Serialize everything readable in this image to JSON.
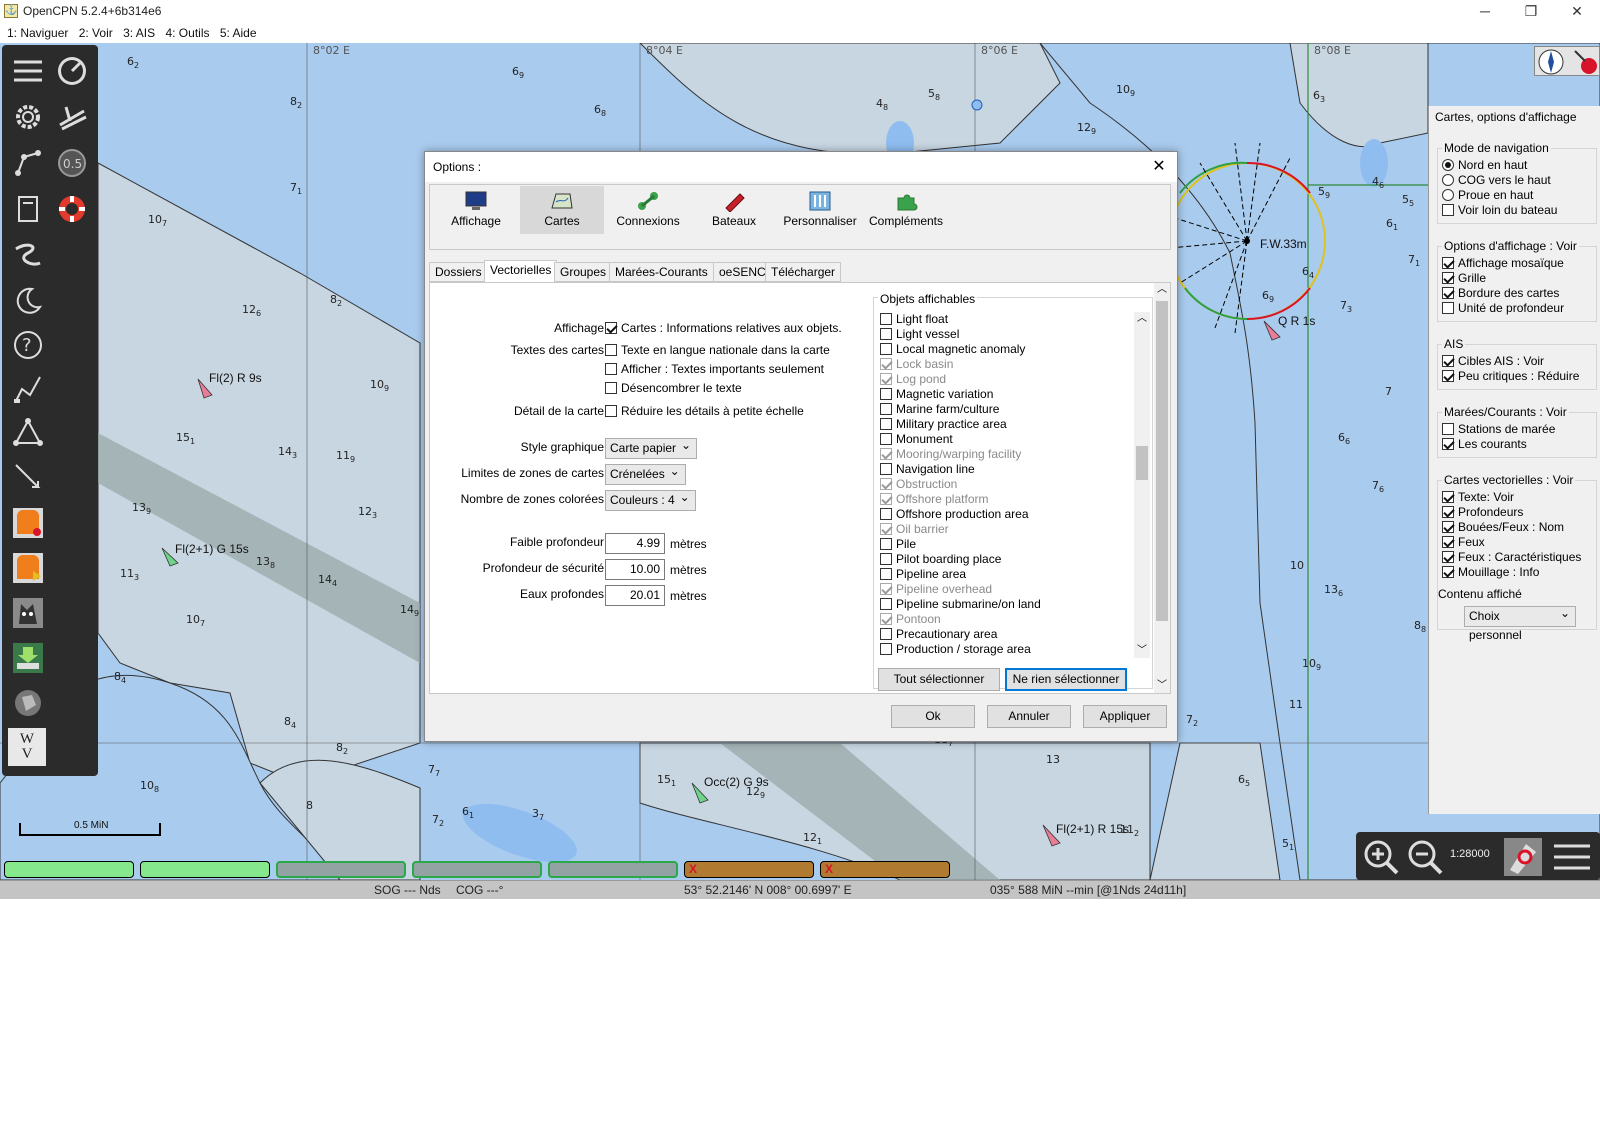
{
  "window": {
    "title": "OpenCPN 5.2.4+6b314e6",
    "app_icon": "chart-icon",
    "controls": [
      "─",
      "❐",
      "✕"
    ]
  },
  "menu": {
    "items": [
      "1: Naviguer",
      "2: Voir",
      "3: AIS",
      "4: Outils",
      "5: Aide"
    ]
  },
  "chart": {
    "grid_labels": [
      "8°02 E",
      "8°04 E",
      "8°06 E",
      "8°08 E"
    ],
    "depths": [
      [
        "6",
        "2"
      ],
      [
        "8",
        "2"
      ],
      [
        "6",
        "9"
      ],
      [
        "6",
        "8"
      ],
      [
        "4",
        "8"
      ],
      [
        "5",
        "8"
      ],
      [
        "10",
        "9"
      ],
      [
        "6",
        "3"
      ],
      [
        "12",
        "9"
      ],
      [
        "7",
        "1"
      ],
      [
        "10",
        "7"
      ],
      [
        "8",
        "2"
      ],
      [
        "12",
        "6"
      ],
      [
        "10",
        "9"
      ],
      [
        "15",
        "1"
      ],
      [
        "14",
        "3"
      ],
      [
        "11",
        "9"
      ],
      [
        "13",
        "9"
      ],
      [
        "12",
        "3"
      ],
      [
        "13",
        "8"
      ],
      [
        "14",
        "4"
      ],
      [
        "11",
        "3"
      ],
      [
        "14",
        "9"
      ],
      [
        "10",
        "7"
      ],
      [
        "8",
        "4"
      ],
      [
        "8",
        "4"
      ],
      [
        "8",
        "2"
      ],
      [
        "7",
        "7"
      ],
      [
        "10",
        "8"
      ],
      [
        "15",
        "1"
      ],
      [
        "12",
        "9"
      ],
      [
        "7",
        "2"
      ],
      [
        "6",
        "1"
      ],
      [
        "3",
        "7"
      ],
      [
        "8",
        ""
      ],
      [
        "11",
        "7"
      ],
      [
        "13",
        ""
      ],
      [
        "6",
        "5"
      ],
      [
        "5",
        "1"
      ],
      [
        "11",
        "2"
      ],
      [
        "12",
        "1"
      ],
      [
        "7",
        "2"
      ],
      [
        "10",
        "9"
      ],
      [
        "13",
        "6"
      ],
      [
        "11",
        "4"
      ],
      [
        "10",
        ""
      ],
      [
        "6",
        "6"
      ],
      [
        "7",
        "6"
      ],
      [
        "7",
        ""
      ],
      [
        "7",
        "3"
      ],
      [
        "6",
        "4"
      ],
      [
        "6",
        "9"
      ],
      [
        "5",
        "9"
      ],
      [
        "4",
        "6"
      ],
      [
        "5",
        "5"
      ],
      [
        "6",
        "1"
      ],
      [
        "7",
        "1"
      ],
      [
        "8",
        "8"
      ],
      [
        "11",
        ""
      ]
    ],
    "buoy_labels": [
      "Fl(2) R 9s",
      "Fl(2+1) G 15s",
      "Occ(2) G 9s",
      "Fl(2+1) R 15s",
      "Q R 1s",
      "F.W.33m"
    ],
    "scale_label": "0.5 MiN",
    "colors": {
      "deep_water": "#a9cbee",
      "shallow": "#c8d6e2",
      "land": "#e8e2c0",
      "channel": "#9aa8a8",
      "highlight_ring": "#d8142a"
    }
  },
  "toolbar": {
    "icons": [
      "menu-icon",
      "speedometer-icon",
      "settings-icon",
      "ship-track-icon",
      "route-icon",
      "scale-0-5-icon",
      "document-icon",
      "lifebuoy-icon",
      "track-icon",
      "night-mode-icon",
      "help-icon",
      "draw-icon",
      "polygon-icon",
      "pencil-icon",
      "orange-square-icon",
      "orange-play-icon",
      "husky-icon",
      "download-icon",
      "globe-icon",
      "wv-icon"
    ],
    "wv_top": "W",
    "wv_bottom": "V"
  },
  "dialog": {
    "title": "Options :",
    "categories": [
      "Affichage",
      "Cartes",
      "Connexions",
      "Bateaux",
      "Personnaliser",
      "Compléments"
    ],
    "active_category": "Cartes",
    "subtabs": [
      "Dossiers",
      "Vectorielles",
      "Groupes",
      "Marées-Courants",
      "oeSENC",
      "Télécharger"
    ],
    "active_subtab": "Vectorielles",
    "labels": {
      "affichage": "Affichage",
      "textes": "Textes des cartes",
      "detail": "Détail de la carte",
      "style": "Style graphique",
      "limites": "Limites de zones de cartes",
      "zones": "Nombre de zones colorées",
      "faible": "Faible profondeur",
      "securite": "Profondeur de sécurité",
      "eaux": "Eaux profondes"
    },
    "options": {
      "infos_objets": "Cartes : Informations relatives aux objets.",
      "langue_nationale": "Texte en langue nationale dans la carte",
      "textes_importants": "Afficher : Textes importants seulement",
      "desencombrer": "Désencombrer le texte",
      "reduire": "Réduire les détails à petite échelle"
    },
    "selects": {
      "style": "Carte papier",
      "limites": "Crénelées",
      "zones": "Couleurs : 4"
    },
    "depths": {
      "faible": "4.99",
      "securite": "10.00",
      "eaux": "20.01",
      "unit": "mètres"
    },
    "objects_title": "Objets affichables",
    "objects": [
      {
        "label": "Light float",
        "checked": false,
        "disabled": false
      },
      {
        "label": "Light vessel",
        "checked": false,
        "disabled": false
      },
      {
        "label": "Local magnetic anomaly",
        "checked": false,
        "disabled": false
      },
      {
        "label": "Lock basin",
        "checked": true,
        "disabled": true
      },
      {
        "label": "Log pond",
        "checked": true,
        "disabled": true
      },
      {
        "label": "Magnetic variation",
        "checked": false,
        "disabled": false
      },
      {
        "label": "Marine farm/culture",
        "checked": false,
        "disabled": false
      },
      {
        "label": "Military practice area",
        "checked": false,
        "disabled": false
      },
      {
        "label": "Monument",
        "checked": false,
        "disabled": false
      },
      {
        "label": "Mooring/warping facility",
        "checked": true,
        "disabled": true
      },
      {
        "label": "Navigation line",
        "checked": false,
        "disabled": false
      },
      {
        "label": "Obstruction",
        "checked": true,
        "disabled": true
      },
      {
        "label": "Offshore platform",
        "checked": true,
        "disabled": true
      },
      {
        "label": "Offshore production area",
        "checked": false,
        "disabled": false
      },
      {
        "label": "Oil barrier",
        "checked": true,
        "disabled": true
      },
      {
        "label": "Pile",
        "checked": false,
        "disabled": false
      },
      {
        "label": "Pilot boarding place",
        "checked": false,
        "disabled": false
      },
      {
        "label": "Pipeline area",
        "checked": false,
        "disabled": false
      },
      {
        "label": "Pipeline overhead",
        "checked": true,
        "disabled": true
      },
      {
        "label": "Pipeline submarine/on land",
        "checked": false,
        "disabled": false
      },
      {
        "label": "Pontoon",
        "checked": true,
        "disabled": true
      },
      {
        "label": "Precautionary area",
        "checked": false,
        "disabled": false
      },
      {
        "label": "Production / storage area",
        "checked": false,
        "disabled": false
      }
    ],
    "btn_select_all": "Tout sélectionner",
    "btn_select_none": "Ne rien sélectionner",
    "btn_ok": "Ok",
    "btn_cancel": "Annuler",
    "btn_apply": "Appliquer"
  },
  "right_panel": {
    "title": "Cartes, options d'affichage",
    "nav_mode": {
      "heading": "Mode de navigation",
      "options": [
        {
          "label": "Nord en haut",
          "checked": true,
          "type": "radio"
        },
        {
          "label": "COG vers le haut",
          "checked": false,
          "type": "radio"
        },
        {
          "label": "Proue en haut",
          "checked": false,
          "type": "radio"
        },
        {
          "label": "Voir loin du bateau",
          "checked": false,
          "type": "check"
        }
      ]
    },
    "display": {
      "heading": "Options d'affichage : Voir",
      "options": [
        {
          "label": "Affichage mosaïque",
          "checked": true
        },
        {
          "label": "Grille",
          "checked": true
        },
        {
          "label": "Bordure des cartes",
          "checked": true
        },
        {
          "label": "Unité de profondeur",
          "checked": false
        }
      ]
    },
    "ais": {
      "heading": "AIS",
      "options": [
        {
          "label": "Cibles AIS : Voir",
          "checked": true
        },
        {
          "label": "Peu critiques : Réduire",
          "checked": true
        }
      ]
    },
    "tides": {
      "heading": "Marées/Courants : Voir",
      "options": [
        {
          "label": "Stations de marée",
          "checked": false
        },
        {
          "label": "Les courants",
          "checked": true
        }
      ]
    },
    "vector": {
      "heading": "Cartes vectorielles : Voir",
      "options": [
        {
          "label": "Texte: Voir",
          "checked": true
        },
        {
          "label": "Profondeurs",
          "checked": true
        },
        {
          "label": "Bouées/Feux : Nom",
          "checked": true
        },
        {
          "label": "Feux",
          "checked": true
        },
        {
          "label": "Feux : Caractéristiques",
          "checked": true
        },
        {
          "label": "Mouillage : Info",
          "checked": true
        }
      ]
    },
    "content_label": "Contenu affiché",
    "content_value": "Choix personnel"
  },
  "zoom_panel": {
    "scale": "1:28000"
  },
  "piano_marks": [
    "X",
    "X"
  ],
  "status_bar": {
    "sog": "SOG --- Nds",
    "cog": "COG ---°",
    "position": "53° 52.2146' N   008° 00.6997' E",
    "range": "035°  588 MiN --min [@1Nds 24d11h]"
  }
}
